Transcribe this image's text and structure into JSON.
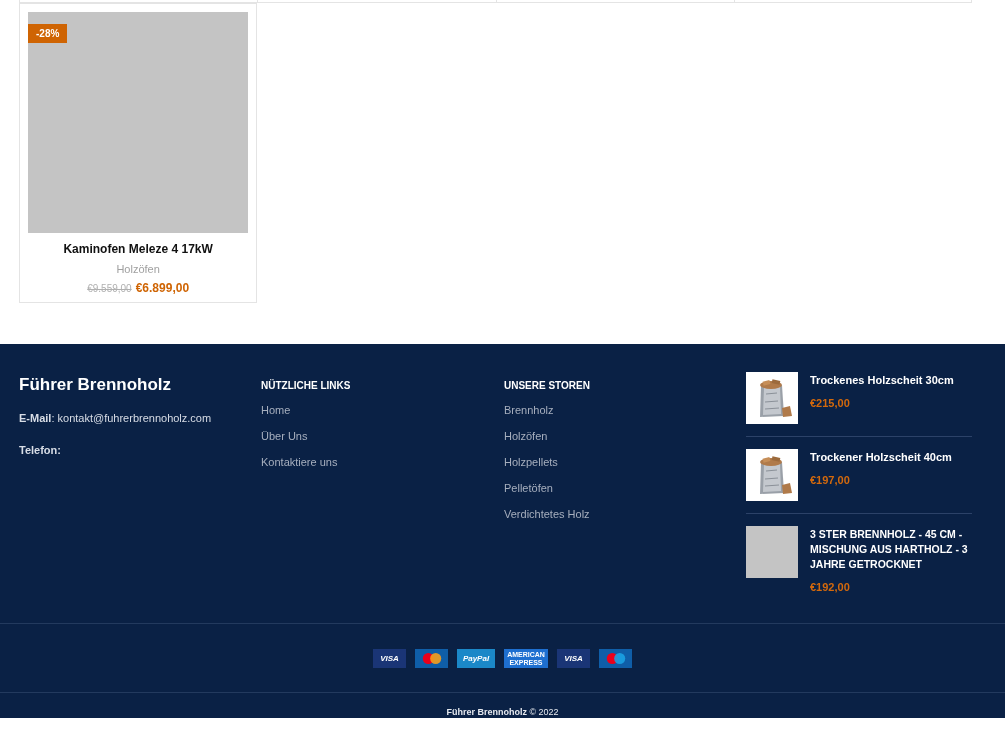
{
  "products": [
    {
      "badge": "-28%",
      "name": "Kaminofen Meleze 4 17kW",
      "category": "Holzöfen",
      "old_price": "€9.559,00",
      "price": "€6.899,00"
    }
  ],
  "footer": {
    "brand": {
      "title": "Führer Brennoholz",
      "lines": [
        {
          "kind": "text",
          "text": "**E-Mail**: kontakt@fuhrerbrennoholz.com"
        },
        {
          "kind": "label",
          "text": "Telefon:"
        }
      ]
    },
    "link_columns": [
      {
        "heading": "NÜTZLICHE LINKS",
        "links": [
          "Home",
          "Über Uns",
          "Kontaktiere uns"
        ]
      },
      {
        "heading": "UNSERE STOREN",
        "links": [
          "Brennholz",
          "Holzöfen",
          "Holzpellets",
          "Pelletöfen",
          "Verdichtetes Holz"
        ]
      }
    ],
    "featured": [
      {
        "kind": "picture",
        "name": "Trockenes Holzscheit 30cm",
        "price": "€215,00"
      },
      {
        "kind": "picture",
        "name": "Trockener Holzscheit 40cm",
        "price": "€197,00"
      },
      {
        "kind": "placeholder",
        "name": "3 STER BRENNHOLZ - 45 CM - MISCHUNG AUS HARTHOLZ - 3 JAHRE GETROCKNET",
        "price": "€192,00"
      }
    ],
    "payment_methods": [
      {
        "kind": "visa",
        "label": "VISA"
      },
      {
        "kind": "mastercard"
      },
      {
        "kind": "paypal",
        "label": "PayPal"
      },
      {
        "kind": "amex",
        "label": "AMERICAN EXPRESS"
      },
      {
        "kind": "visa",
        "label": "VISA"
      },
      {
        "kind": "maestro"
      }
    ],
    "copyright": "**Führer Brennoholz** © 2022"
  }
}
